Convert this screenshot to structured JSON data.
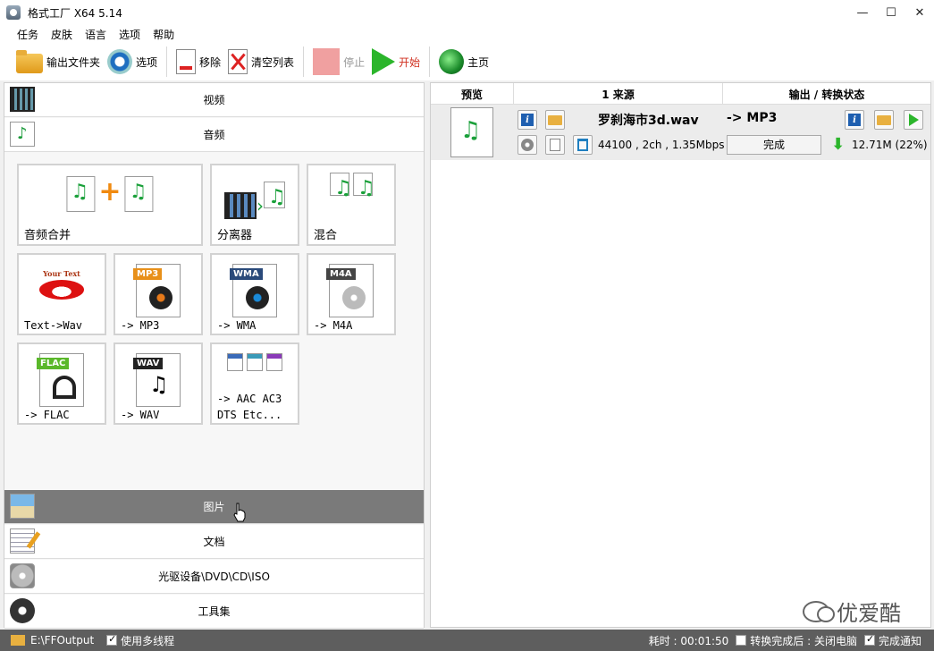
{
  "window": {
    "title": "格式工厂 X64 5.14",
    "controls": {
      "minimize": "—",
      "maximize": "☐",
      "close": "✕"
    }
  },
  "menu": [
    "任务",
    "皮肤",
    "语言",
    "选项",
    "帮助"
  ],
  "toolbar": {
    "output_folder": "输出文件夹",
    "options": "选项",
    "remove": "移除",
    "clear_list": "清空列表",
    "stop": "停止",
    "start": "开始",
    "home": "主页"
  },
  "categories": {
    "video": "视频",
    "audio": "音频",
    "image": "图片",
    "document": "文档",
    "disc": "光驱设备\\DVD\\CD\\ISO",
    "tools": "工具集"
  },
  "audio_tiles": {
    "merge": "音频合并",
    "splitter": "分离器",
    "mix": "混合",
    "text_to_wav": "Text->Wav",
    "your_text": "Your Text",
    "mp3": "-> MP3",
    "wma": "-> WMA",
    "m4a": "-> M4A",
    "flac": "-> FLAC",
    "wav": "-> WAV",
    "aac_line1": "-> AAC AC3",
    "aac_line2": "DTS Etc...",
    "badges": {
      "mp3": "MP3",
      "wma": "WMA",
      "m4a": "M4A",
      "flac": "FLAC",
      "wav": "WAV"
    }
  },
  "table": {
    "headers": {
      "preview": "预览",
      "source": "1 来源",
      "output": "输出 / 转换状态"
    },
    "rows": [
      {
        "file": "罗刹海市3d.wav",
        "info": "44100 , 2ch , 1.35Mbps",
        "format": "-> MP3",
        "status": "完成",
        "size": "12.71M",
        "ratio": "(22%)"
      }
    ]
  },
  "watermark": "优爱酷",
  "status": {
    "path": "E:\\FFOutput",
    "multithread": "使用多线程",
    "elapsed": "耗时 : 00:01:50",
    "after_convert": "转换完成后 : 关闭电脑",
    "notify": "完成通知"
  },
  "colors": {
    "accent_green": "#2bb52b",
    "status_bar": "#5e5e5e",
    "active_category": "#7a7a7a",
    "start_label": "#d03020"
  }
}
